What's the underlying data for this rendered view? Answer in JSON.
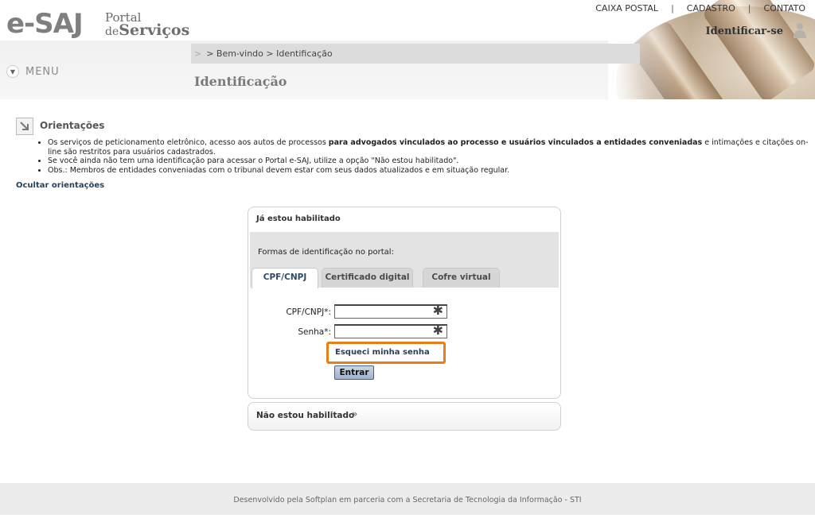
{
  "logo": {
    "esaj": "e-SAJ",
    "portal": "Portal",
    "de": "de",
    "servicos": "Serviços"
  },
  "top_links": [
    "CAIXA POSTAL",
    "CADASTRO",
    "CONTATO"
  ],
  "top_links_separator": "|",
  "identify_label": "Identificar-se",
  "menu_label": "MENU",
  "breadcrumb": "> Bem-vindo > Identificação",
  "page_title": "Identificação",
  "orientations": {
    "title": "Orientações",
    "item1_before": "Os serviços de peticionamento eletrônico, acesso aos autos de processos ",
    "item1_bold": "para advogados vinculados ao processo e usuários vinculados a entidades conveniadas",
    "item1_after": " e intimações e citações on-line são restritos para usuários cadastrados.",
    "item2": "Se você ainda não tem uma identificação para acessar o Portal e-SAJ, utilize a opção \"Não estou habilitado\".",
    "item3": "Obs.: Membros de entidades conveniadas com o tribunal devem estar com seus dados atualizados e em situação regular.",
    "hide_link": "Ocultar orientações"
  },
  "login": {
    "title": "Já estou habilitado",
    "forms_label": "Formas de identificação no portal:",
    "tabs": [
      "CPF/CNPJ",
      "Certificado digital",
      "Cofre virtual"
    ],
    "active_tab": "CPF/CNPJ",
    "cpf_label": "CPF/CNPJ*:",
    "password_label": "Senha*:",
    "cpf_value": "",
    "password_value": "",
    "forgot_password": "Esqueci minha senha",
    "enter_button": "Entrar"
  },
  "not_enabled": {
    "label": "Não estou habilitado",
    "chevron": "»"
  },
  "footer": "Desenvolvido pela Softplan em parceria com a Secretaria de Tecnologia da Informação - STI",
  "colors": {
    "highlight": "#e87e14",
    "link": "#24435f",
    "tab_active_text": "#2b4a66"
  }
}
